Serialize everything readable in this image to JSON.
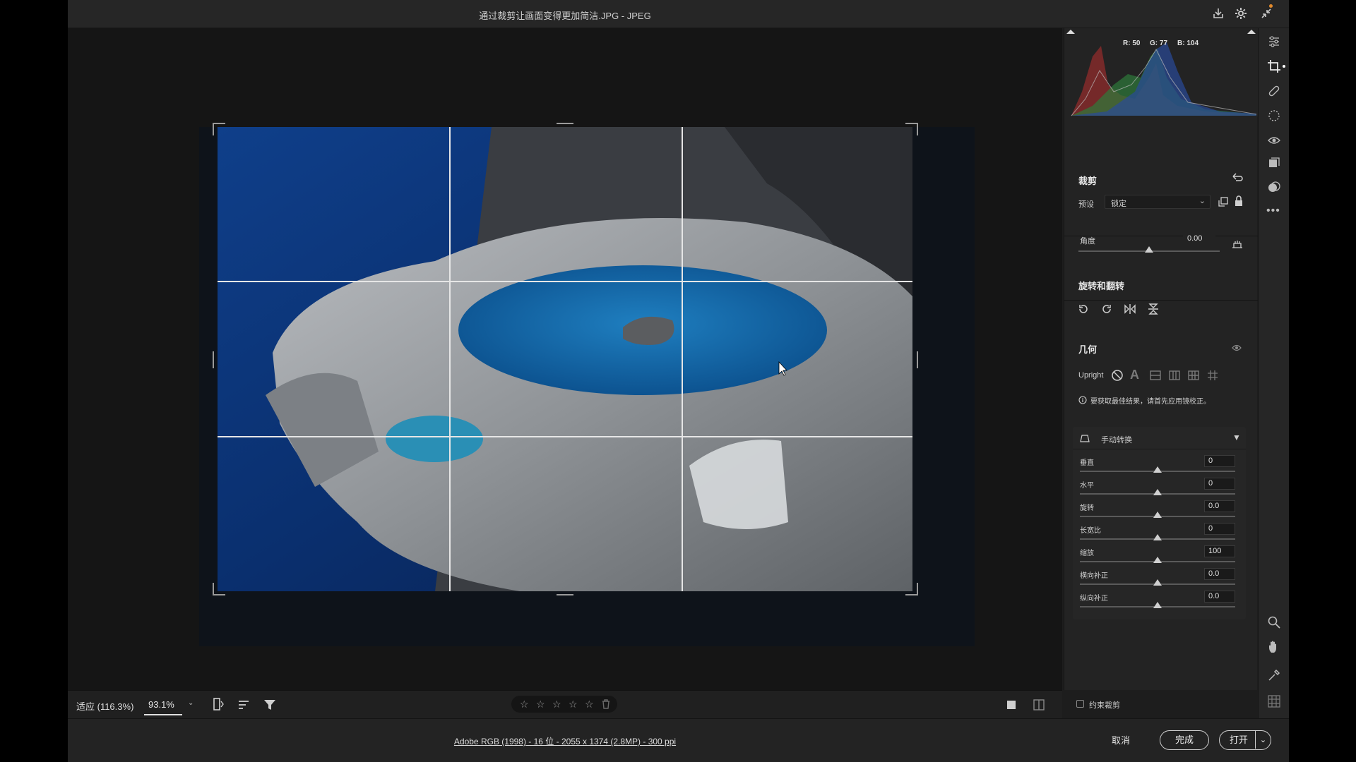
{
  "window": {
    "title": "通过裁剪让画面变得更加简洁.JPG -  JPEG"
  },
  "histogram": {
    "r_label": "R: 50",
    "g_label": "G: 77",
    "b_label": "B: 104"
  },
  "crop": {
    "title": "裁剪",
    "preset_label": "预设",
    "preset_value": "锁定",
    "angle_label": "角度",
    "angle_value": "0.00",
    "angle_fraction": 0.5
  },
  "rotate_flip": {
    "title": "旋转和翻转"
  },
  "geometry": {
    "title": "几何",
    "upright_label": "Upright",
    "info_text": "要获取最佳结果，请首先应用镜校正。",
    "manual_title": "手动转换",
    "sliders": [
      {
        "label": "垂直",
        "value": "0",
        "fraction": 0.5
      },
      {
        "label": "水平",
        "value": "0",
        "fraction": 0.5
      },
      {
        "label": "旋转",
        "value": "0.0",
        "fraction": 0.5
      },
      {
        "label": "长宽比",
        "value": "0",
        "fraction": 0.5
      },
      {
        "label": "缩放",
        "value": "100",
        "fraction": 0.5
      },
      {
        "label": "横向补正",
        "value": "0.0",
        "fraction": 0.5
      },
      {
        "label": "纵向补正",
        "value": "0.0",
        "fraction": 0.5
      }
    ]
  },
  "constrain": {
    "label": "约束裁剪"
  },
  "bottom": {
    "fit_label": "适应 (116.3%)",
    "zoom_value": "93.1%",
    "rating_stars": 0
  },
  "status": {
    "file_info": "Adobe RGB (1998) - 16 位 - 2055 x 1374 (2.8MP) - 300 ppi",
    "cancel": "取消",
    "done": "完成",
    "open": "打开"
  },
  "colors": {
    "accent": "#2f7fd6",
    "panel": "#232323"
  }
}
